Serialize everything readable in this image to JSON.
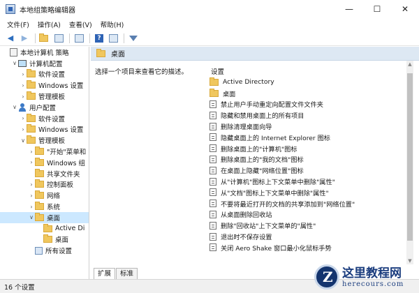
{
  "window": {
    "title": "本地组策略编辑器",
    "controls": {
      "minimize": "—",
      "maximize": "☐",
      "close": "✕"
    }
  },
  "menu": [
    "文件(F)",
    "操作(A)",
    "查看(V)",
    "帮助(H)"
  ],
  "toolbar": {
    "icons": [
      "back-arrow-icon",
      "forward-arrow-icon",
      "folder-up-icon",
      "show-hide-tree-icon",
      "export-list-icon",
      "help-icon",
      "properties-icon",
      "filter-icon"
    ]
  },
  "tree": [
    {
      "label": "本地计算机 策略",
      "level": 0,
      "expander": "",
      "icon": "policy"
    },
    {
      "label": "计算机配置",
      "level": 1,
      "expander": "∨",
      "icon": "pc"
    },
    {
      "label": "软件设置",
      "level": 2,
      "expander": "›",
      "icon": "folder"
    },
    {
      "label": "Windows 设置",
      "level": 2,
      "expander": "›",
      "icon": "folder"
    },
    {
      "label": "管理模板",
      "level": 2,
      "expander": "›",
      "icon": "folder"
    },
    {
      "label": "用户配置",
      "level": 1,
      "expander": "∨",
      "icon": "user"
    },
    {
      "label": "软件设置",
      "level": 2,
      "expander": "›",
      "icon": "folder"
    },
    {
      "label": "Windows 设置",
      "level": 2,
      "expander": "›",
      "icon": "folder"
    },
    {
      "label": "管理模板",
      "level": 2,
      "expander": "∨",
      "icon": "folder"
    },
    {
      "label": "\"开始\"菜单和",
      "level": 3,
      "expander": "›",
      "icon": "folder"
    },
    {
      "label": "Windows 组",
      "level": 3,
      "expander": "›",
      "icon": "folder"
    },
    {
      "label": "共享文件夹",
      "level": 3,
      "expander": "",
      "icon": "folder"
    },
    {
      "label": "控制面板",
      "level": 3,
      "expander": "›",
      "icon": "folder"
    },
    {
      "label": "网络",
      "level": 3,
      "expander": "›",
      "icon": "folder"
    },
    {
      "label": "系统",
      "level": 3,
      "expander": "›",
      "icon": "folder"
    },
    {
      "label": "桌面",
      "level": 3,
      "expander": "∨",
      "icon": "folder",
      "selected": true
    },
    {
      "label": "Active Di",
      "level": 4,
      "expander": "",
      "icon": "folder"
    },
    {
      "label": "桌面",
      "level": 4,
      "expander": "",
      "icon": "folder"
    },
    {
      "label": "所有设置",
      "level": 3,
      "expander": "",
      "icon": "allset"
    }
  ],
  "content": {
    "header": "桌面",
    "description": "选择一个项目来查看它的描述。",
    "column_header": "设置",
    "items": [
      {
        "label": "Active Directory",
        "type": "folder"
      },
      {
        "label": "桌面",
        "type": "folder"
      },
      {
        "label": "禁止用户手动重定向配置文件文件夹",
        "type": "policy"
      },
      {
        "label": "隐藏和禁用桌面上的所有项目",
        "type": "policy"
      },
      {
        "label": "删除清理桌面向导",
        "type": "policy"
      },
      {
        "label": "隐藏桌面上的 Internet Explorer 图标",
        "type": "policy"
      },
      {
        "label": "删除桌面上的\"计算机\"图标",
        "type": "policy"
      },
      {
        "label": "删除桌面上的\"我的文档\"图标",
        "type": "policy"
      },
      {
        "label": "在桌面上隐藏\"网络位置\"图标",
        "type": "policy"
      },
      {
        "label": "从\"计算机\"图标上下文菜单中删除\"属性\"",
        "type": "policy"
      },
      {
        "label": "从\"文档\"图标上下文菜单中删除\"属性\"",
        "type": "policy"
      },
      {
        "label": "不要将最近打开的文档的共享添加到\"网络位置\"",
        "type": "policy"
      },
      {
        "label": "从桌面删除回收站",
        "type": "policy"
      },
      {
        "label": "删除\"回收站\"上下文菜单的\"属性\"",
        "type": "policy"
      },
      {
        "label": "退出时不保存设置",
        "type": "policy"
      },
      {
        "label": "关闭 Aero Shake 窗口最小化鼠标手势",
        "type": "policy"
      }
    ]
  },
  "tabs": [
    "扩展",
    "标准"
  ],
  "status": "16 个设置",
  "watermark": {
    "name": "这里教程网",
    "url": "herecours.com"
  }
}
